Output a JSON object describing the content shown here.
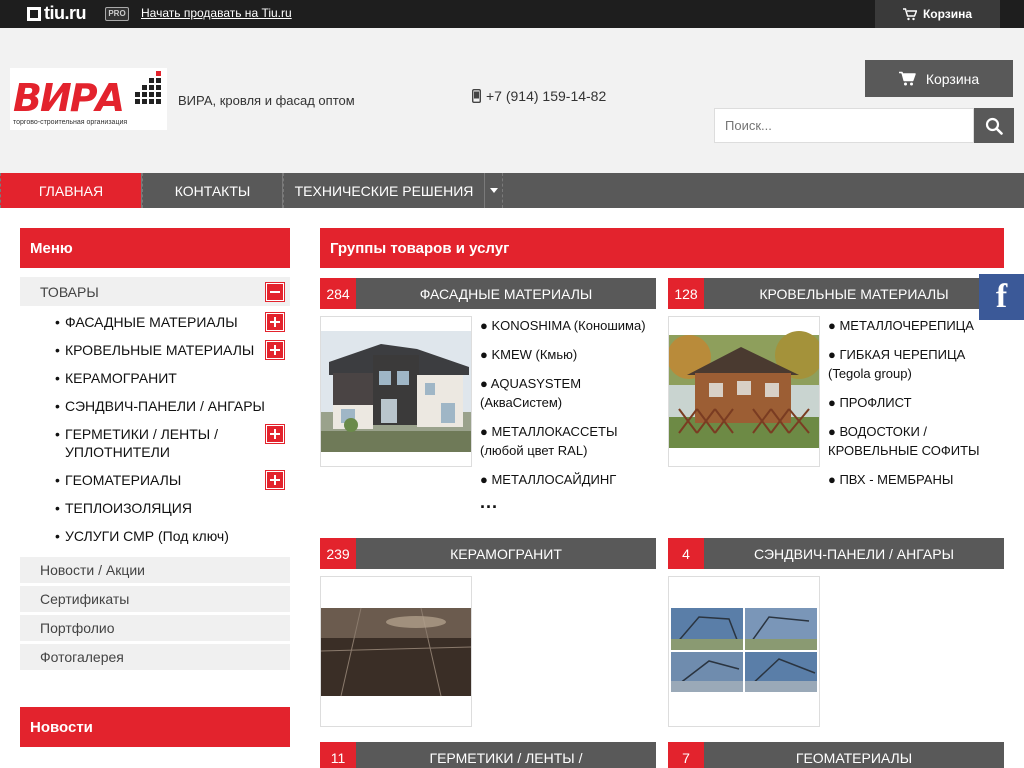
{
  "topbar": {
    "brand": "tiu.ru",
    "pro_badge": "PRO",
    "sell_link": "Начать продавать на Tiu.ru",
    "cart_label": "Корзина"
  },
  "header": {
    "logo_text": "ВИРА",
    "logo_subtitle": "торгово-строительная организация",
    "slogan": "ВИРА, кровля и фасад оптом",
    "phone": "+7 (914) 159-14-82",
    "cart_label": "Корзина",
    "search_placeholder": "Поиск..."
  },
  "nav": {
    "items": [
      {
        "label": "ГЛАВНАЯ",
        "active": true
      },
      {
        "label": "КОНТАКТЫ",
        "active": false
      },
      {
        "label": "ТЕХНИЧЕСКИЕ РЕШЕНИЯ",
        "active": false
      }
    ]
  },
  "sidebar": {
    "menu_title": "Меню",
    "category": "ТОВАРЫ",
    "subcategories": [
      {
        "label": "ФАСАДНЫЕ МАТЕРИАЛЫ",
        "expandable": true
      },
      {
        "label": "КРОВЕЛЬНЫЕ МАТЕРИАЛЫ",
        "expandable": true
      },
      {
        "label": "КЕРАМОГРАНИТ",
        "expandable": false
      },
      {
        "label": "СЭНДВИЧ-ПАНЕЛИ / АНГАРЫ",
        "expandable": false
      },
      {
        "label": "ГЕРМЕТИКИ / ЛЕНТЫ / УПЛОТНИТЕЛИ",
        "expandable": true
      },
      {
        "label": "ГЕОМАТЕРИАЛЫ",
        "expandable": true
      },
      {
        "label": "ТЕПЛОИЗОЛЯЦИЯ",
        "expandable": false
      },
      {
        "label": "УСЛУГИ СМР (Под ключ)",
        "expandable": false
      }
    ],
    "links": [
      "Новости / Акции",
      "Сертификаты",
      "Портфолио",
      "Фотогалерея"
    ],
    "news_title": "Новости"
  },
  "main": {
    "title": "Группы товаров и услуг",
    "groups": [
      {
        "count": "284",
        "title": "ФАСАДНЫЕ МАТЕРИАЛЫ",
        "items": [
          "● KONOSHIMA (Коношима)",
          "● KMEW (Кмью)",
          "● AQUASYSTEM (АкваСистем)",
          "● МЕТАЛЛОКАССЕТЫ (любой цвет RAL)",
          "● МЕТАЛЛОСАЙДИНГ"
        ],
        "more": "..."
      },
      {
        "count": "128",
        "title": "КРОВЕЛЬНЫЕ МАТЕРИАЛЫ",
        "items": [
          "● МЕТАЛЛОЧЕРЕПИЦА",
          "● ГИБКАЯ ЧЕРЕПИЦА (Tegola group)",
          "● ПРОФЛИСТ",
          "● ВОДОСТОКИ / КРОВЕЛЬНЫЕ СОФИТЫ",
          "● ПВХ - МЕМБРАНЫ"
        ]
      },
      {
        "count": "239",
        "title": "КЕРАМОГРАНИТ"
      },
      {
        "count": "4",
        "title": "СЭНДВИЧ-ПАНЕЛИ / АНГАРЫ"
      },
      {
        "count": "11",
        "title": "ГЕРМЕТИКИ / ЛЕНТЫ /"
      },
      {
        "count": "7",
        "title": "ГЕОМАТЕРИАЛЫ"
      }
    ]
  },
  "social": {
    "facebook_glyph": "f"
  },
  "colors": {
    "accent": "#e3232d",
    "dark": "#595959",
    "topbar": "#1e1e1e"
  }
}
